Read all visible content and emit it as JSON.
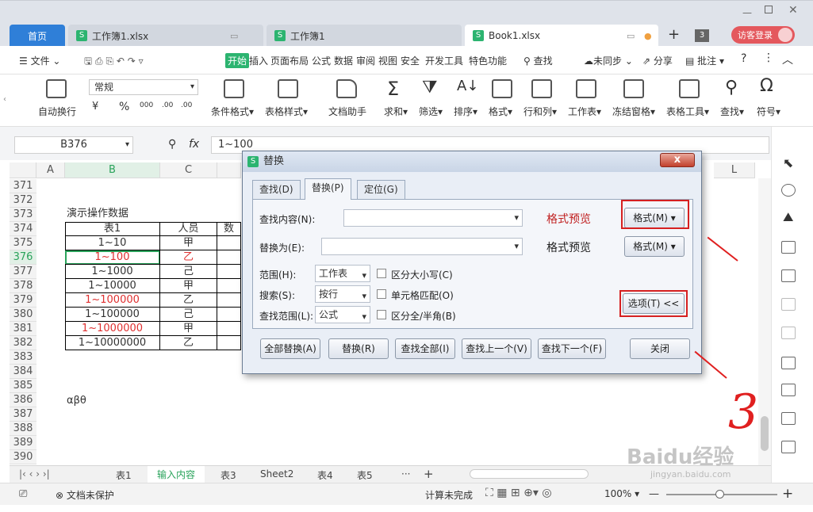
{
  "titlebar": {
    "tabs": [
      {
        "label": "首页"
      },
      {
        "label": "工作簿1.xlsx"
      },
      {
        "label": "工作簿1"
      },
      {
        "label": "Book1.xlsx"
      }
    ],
    "add_tab": "+",
    "badge": "3",
    "login": "访客登录"
  },
  "menu": {
    "file": "文件",
    "items": [
      "开始",
      "插入",
      "页面布局",
      "公式",
      "数据",
      "审阅",
      "视图",
      "安全",
      "开发工具",
      "特色功能"
    ],
    "search": "查找",
    "sync": "未同步",
    "share": "分享",
    "comment": "批注",
    "help": "?"
  },
  "ribbon": {
    "wrap": "自动换行",
    "number_format": "常规",
    "number_btns": [
      "¥",
      "%",
      "000",
      ".00"
    ],
    "items": [
      {
        "label": "条件格式"
      },
      {
        "label": "表格样式"
      },
      {
        "label": "文档助手"
      },
      {
        "label": "求和"
      },
      {
        "label": "筛选"
      },
      {
        "label": "排序"
      },
      {
        "label": "格式"
      },
      {
        "label": "行和列"
      },
      {
        "label": "工作表"
      },
      {
        "label": "冻结窗格"
      },
      {
        "label": "表格工具"
      },
      {
        "label": "查找"
      },
      {
        "label": "符号"
      }
    ]
  },
  "formula_bar": {
    "cell_ref": "B376",
    "fx": "fx",
    "value": "1~100"
  },
  "sheet": {
    "columns": [
      "A",
      "B",
      "C",
      "L"
    ],
    "rows": [
      "371",
      "372",
      "373",
      "374",
      "375",
      "376",
      "377",
      "378",
      "379",
      "380",
      "381",
      "382",
      "383",
      "384",
      "385",
      "386",
      "387",
      "388",
      "389",
      "390"
    ],
    "title": "演示操作数据",
    "header": {
      "b": "表1",
      "c": "人员",
      "d": "数"
    },
    "data": [
      {
        "b": "1~10",
        "c": "甲"
      },
      {
        "b": "1~100",
        "c": "乙"
      },
      {
        "b": "1~1000",
        "c": "己"
      },
      {
        "b": "1~10000",
        "c": "甲"
      },
      {
        "b": "1~100000",
        "c": "乙"
      },
      {
        "b": "1~100000",
        "c": "己"
      },
      {
        "b": "1~1000000",
        "c": "甲"
      },
      {
        "b": "1~10000000",
        "c": "乙"
      }
    ],
    "greek": "αβθ",
    "colors": {
      "red": "#e03030",
      "selection": "#2aa35b"
    }
  },
  "sheet_tabs": [
    "表1",
    "输入内容",
    "表3",
    "Sheet2",
    "表4",
    "表5"
  ],
  "status": {
    "protect": "文档未保护",
    "calc": "计算未完成",
    "zoom": "100%"
  },
  "dialog": {
    "title": "替换",
    "close": "x",
    "tabs": [
      "查找(D)",
      "替换(P)",
      "定位(G)"
    ],
    "find_label": "查找内容(N):",
    "replace_label": "替换为(E):",
    "preview_find": "格式预览",
    "preview_replace": "格式预览",
    "format_btn": "格式(M)",
    "format_btn2": "格式(M)",
    "scope_label": "范围(H):",
    "scope_value": "工作表",
    "search_label": "搜索(S):",
    "search_value": "按行",
    "lookin_label": "查找范围(L):",
    "lookin_value": "公式",
    "chk_case": "区分大小写(C)",
    "chk_cell": "单元格匹配(O)",
    "chk_width": "区分全/半角(B)",
    "options_btn": "选项(T) <<",
    "buttons": [
      "全部替换(A)",
      "替换(R)",
      "查找全部(I)",
      "查找上一个(V)",
      "查找下一个(F)"
    ],
    "close_btn": "关闭",
    "accent": "#d62020"
  },
  "annotation": {
    "number": "3"
  },
  "watermark": {
    "text": "Baidu经验",
    "url": "jingyan.baidu.com"
  }
}
